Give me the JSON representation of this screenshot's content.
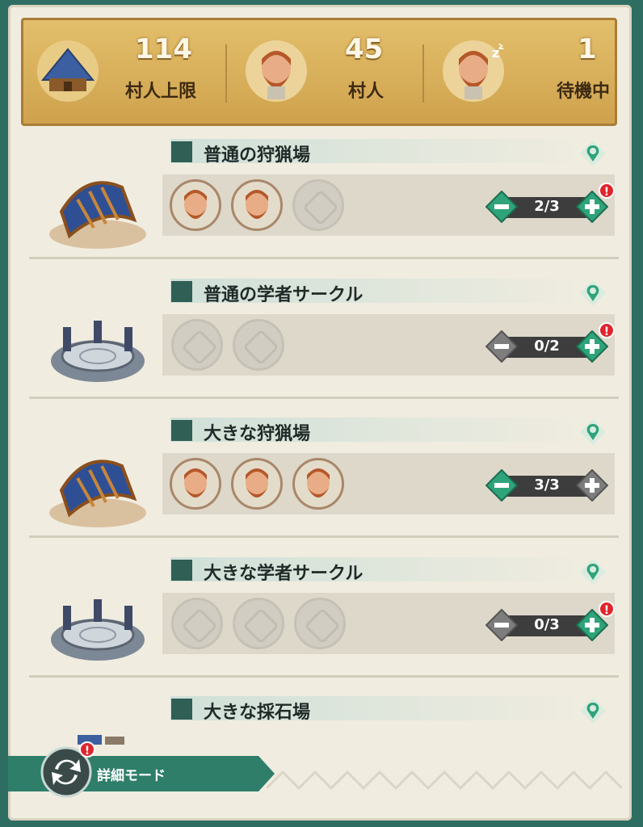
{
  "header": {
    "capacity": {
      "value": "114",
      "label": "村人上限"
    },
    "villagers": {
      "value": "45",
      "label": "村人"
    },
    "idle": {
      "value": "1",
      "label": "待機中"
    }
  },
  "sections": [
    {
      "title": "普通の狩猟場",
      "count": "2/3",
      "filled": 2,
      "slots": 3,
      "minus_active": true,
      "plus_active": true,
      "alert": true,
      "building": "hunting-lodge"
    },
    {
      "title": "普通の学者サークル",
      "count": "0/2",
      "filled": 0,
      "slots": 2,
      "minus_active": false,
      "plus_active": true,
      "alert": true,
      "building": "scholar-circle"
    },
    {
      "title": "大きな狩猟場",
      "count": "3/3",
      "filled": 3,
      "slots": 3,
      "minus_active": true,
      "plus_active": false,
      "alert": false,
      "building": "hunting-lodge"
    },
    {
      "title": "大きな学者サークル",
      "count": "0/3",
      "filled": 0,
      "slots": 3,
      "minus_active": false,
      "plus_active": true,
      "alert": true,
      "building": "scholar-circle"
    },
    {
      "title": "大きな採石場",
      "building": "quarry"
    }
  ],
  "footer": {
    "label": "詳細モード",
    "alert": "!"
  },
  "badge_text": "!",
  "colors": {
    "accent_green": "#2fa37a",
    "gold": "#d9b05a",
    "inactive": "#7d7d7d"
  }
}
